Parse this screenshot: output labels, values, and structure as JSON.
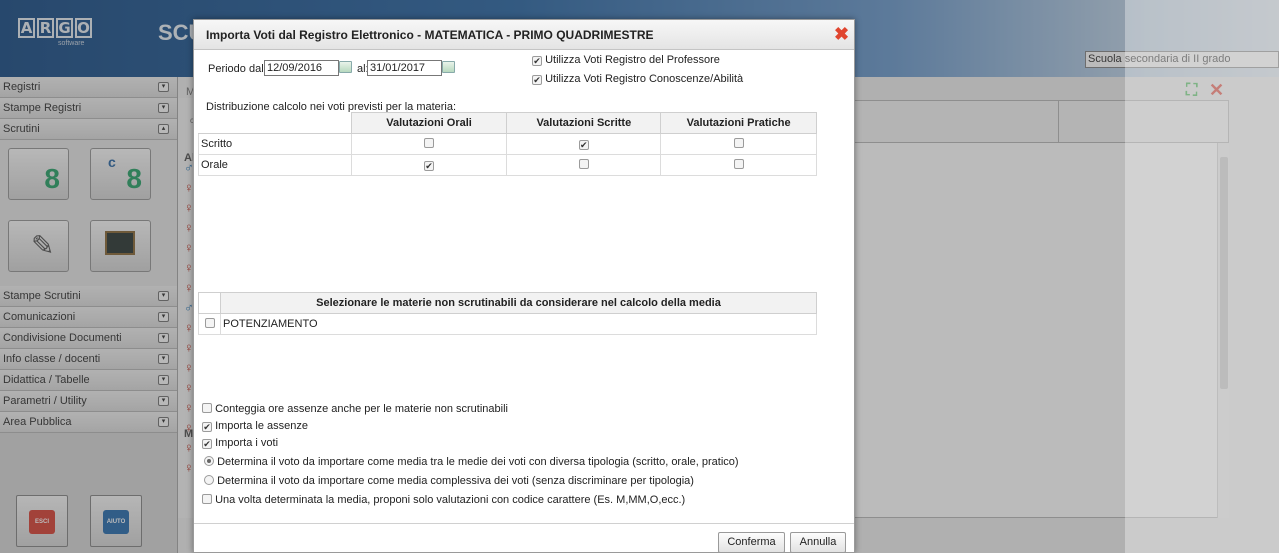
{
  "header": {
    "logo_letters": [
      "A",
      "R",
      "G",
      "O"
    ],
    "logo_sub": "software",
    "brand": "SCU",
    "school": "Scuola secondaria di II grado"
  },
  "sidebar": {
    "top_items": [
      {
        "label": "Registri"
      },
      {
        "label": "Stampe Registri"
      },
      {
        "label": "Scrutini"
      }
    ],
    "bottom_items": [
      {
        "label": "Stampe Scrutini"
      },
      {
        "label": "Comunicazioni"
      },
      {
        "label": "Condivisione Documenti"
      },
      {
        "label": "Info classe / docenti"
      },
      {
        "label": "Didattica / Tabelle"
      },
      {
        "label": "Parametri / Utility"
      },
      {
        "label": "Area Pubblica"
      }
    ],
    "tile_number": "8",
    "tile_c": "c",
    "exit_label": "ESCI",
    "help_label": "AIUTO"
  },
  "background": {
    "strip_letters": [
      "M",
      "c",
      "Al",
      "MI"
    ]
  },
  "dialog": {
    "title": "Importa Voti dal Registro Elettronico - MATEMATICA - PRIMO QUADRIMESTRE",
    "period_label": "Periodo dal:",
    "date_from": "12/09/2016",
    "to_label": "al:",
    "date_to": "31/01/2017",
    "opt_professore": "Utilizza Voti Registro del Professore",
    "opt_conoscenze": "Utilizza Voti Registro Conoscenze/Abilità",
    "distribution_label": "Distribuzione calcolo nei voti previsti per la materia:",
    "dist_headers": [
      "",
      "Valutazioni Orali",
      "Valutazioni Scritte",
      "Valutazioni Pratiche"
    ],
    "dist_rows": [
      {
        "label": "Scritto",
        "orali": false,
        "scritte": true,
        "pratiche": false
      },
      {
        "label": "Orale",
        "orali": true,
        "scritte": false,
        "pratiche": false
      }
    ],
    "subjects_header": "Selezionare le materie non scrutinabili da considerare nel calcolo della media",
    "subjects": [
      {
        "label": "POTENZIAMENTO",
        "checked": false
      }
    ],
    "opt_conteggia": "Conteggia ore assenze anche per le materie non scrutinabili",
    "opt_assenze": "Importa le assenze",
    "opt_voti": "Importa i voti",
    "radio_tipologia": "Determina il voto da importare come media tra le medie dei voti con diversa tipologia (scritto, orale, pratico)",
    "radio_complessiva": "Determina il voto da importare come media complessiva dei voti (senza discriminare per tipologia)",
    "opt_carattere": "Una volta determinata la media, proponi solo valutazioni con codice carattere (Es. M,MM,O,ecc.)",
    "confirm": "Conferma",
    "cancel": "Annulla"
  },
  "colors": {
    "close_red": "#e0452f",
    "header_blue": "#1d4f87",
    "tile_green": "#2ca46a"
  }
}
